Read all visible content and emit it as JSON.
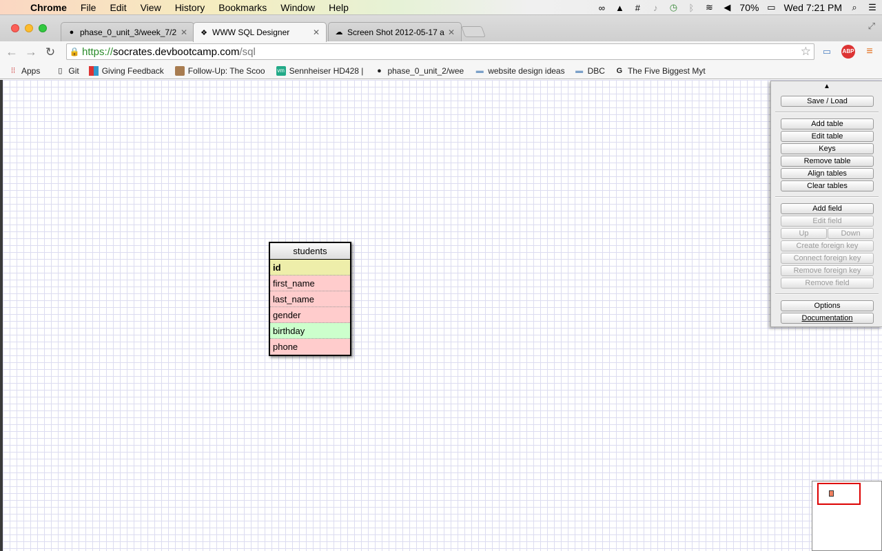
{
  "menubar": {
    "app": "Chrome",
    "items": [
      "File",
      "Edit",
      "View",
      "History",
      "Bookmarks",
      "Window",
      "Help"
    ],
    "battery": "70%",
    "clock": "Wed 7:21 PM"
  },
  "tabs": [
    {
      "title": "phase_0_unit_3/week_7/2",
      "icon": "github-icon"
    },
    {
      "title": "WWW SQL Designer",
      "icon": "sql-designer-icon"
    },
    {
      "title": "Screen Shot 2012-05-17 a",
      "icon": "cloud-icon"
    }
  ],
  "address": {
    "scheme": "https://",
    "host": "socrates.devbootcamp.com",
    "path": "/sql"
  },
  "bookmarks": [
    {
      "label": "Apps",
      "icon": "apps-grid-icon"
    },
    {
      "label": "Git",
      "icon": "page-icon"
    },
    {
      "label": "Giving Feedback",
      "icon": "colorful-square-icon"
    },
    {
      "label": "Follow-Up: The Scoo",
      "icon": "person-icon"
    },
    {
      "label": "Sennheiser HD428 |",
      "icon": "vm-icon"
    },
    {
      "label": "phase_0_unit_2/wee",
      "icon": "github-icon"
    },
    {
      "label": "website design ideas",
      "icon": "folder-icon"
    },
    {
      "label": "DBC",
      "icon": "folder-icon"
    },
    {
      "label": "The Five Biggest Myt",
      "icon": "google-icon"
    }
  ],
  "table": {
    "name": "students",
    "rows": [
      {
        "label": "id",
        "color": "#eeeeaa",
        "bold": true
      },
      {
        "label": "first_name",
        "color": "#ffcccc"
      },
      {
        "label": "last_name",
        "color": "#ffcccc"
      },
      {
        "label": "gender",
        "color": "#ffcccc"
      },
      {
        "label": "birthday",
        "color": "#ccffcc"
      },
      {
        "label": "phone",
        "color": "#ffcccc"
      }
    ]
  },
  "controls": {
    "toggle": "▲",
    "save_load": "Save / Load",
    "add_table": "Add table",
    "edit_table": "Edit table",
    "keys": "Keys",
    "remove_table": "Remove table",
    "align_tables": "Align tables",
    "clear_tables": "Clear tables",
    "add_field": "Add field",
    "edit_field": "Edit field",
    "up": "Up",
    "down": "Down",
    "create_fk": "Create foreign key",
    "connect_fk": "Connect foreign key",
    "remove_fk": "Remove foreign key",
    "remove_field": "Remove field",
    "options": "Options",
    "documentation": "Documentation"
  }
}
